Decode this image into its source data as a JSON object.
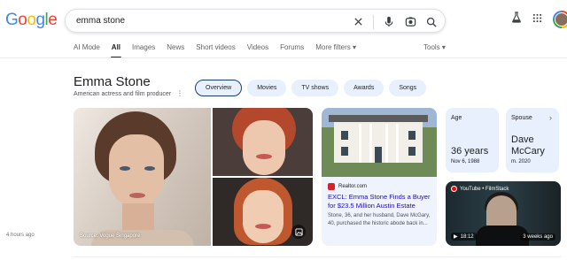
{
  "logo": {
    "letters": [
      "G",
      "o",
      "o",
      "g",
      "l",
      "e"
    ]
  },
  "search": {
    "query": "emma stone"
  },
  "tabs": [
    {
      "label": "AI Mode"
    },
    {
      "label": "All"
    },
    {
      "label": "Images"
    },
    {
      "label": "News"
    },
    {
      "label": "Short videos"
    },
    {
      "label": "Videos"
    },
    {
      "label": "Forums"
    },
    {
      "label": "More filters ▾"
    }
  ],
  "tools_label": "Tools ▾",
  "knowledge_panel": {
    "title": "Emma Stone",
    "subtitle": "American actress and film producer",
    "chips": [
      "Overview",
      "Movies",
      "TV shows",
      "Awards",
      "Songs"
    ]
  },
  "image_caption": "Source: Vogue Singapore",
  "news": {
    "source": "Realtor.com",
    "title": "EXCL: Emma Stone Finds a Buyer for $23.5 Million Austin Estate",
    "snippet": "Stone, 36, and her husband, Dave McGary, 40, purchased the historic abode back in...",
    "time": "4 hours ago"
  },
  "facts": {
    "age": {
      "label": "Age",
      "value": "36 years",
      "sub": "Nov 6, 1988"
    },
    "spouse": {
      "label": "Spouse",
      "value_line1": "Dave",
      "value_line2": "McCary",
      "sub": "m. 2020"
    }
  },
  "video": {
    "source": "YouTube • FilmStack",
    "duration": "18:12",
    "age": "3 weeks ago"
  },
  "colors": {
    "accent": "#1a0dab",
    "chip_bg": "#e8f0fe",
    "youtube_red": "#ff0000"
  }
}
